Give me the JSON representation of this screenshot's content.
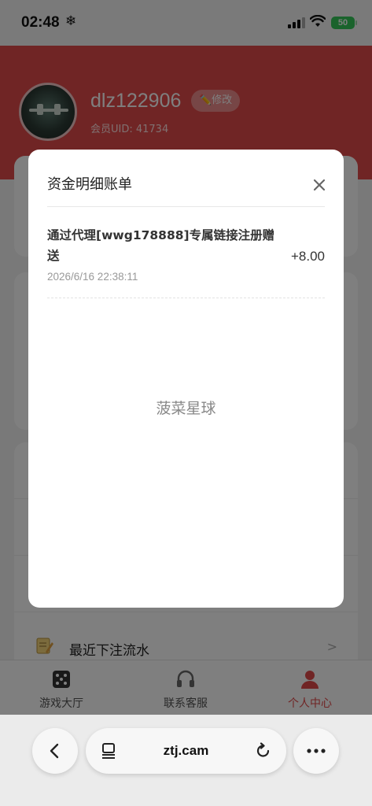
{
  "status_bar": {
    "time": "02:48",
    "battery": "50"
  },
  "profile": {
    "username": "dlz122906",
    "edit_label": "✏️修改",
    "uid_text": "会员UID: 41734"
  },
  "recent_bets": {
    "label": "最近下注流水",
    "arrow": ">"
  },
  "tab_bar": {
    "tabs": [
      {
        "label": "游戏大厅",
        "icon": "dice-icon",
        "active": false
      },
      {
        "label": "联系客服",
        "icon": "headset-icon",
        "active": false
      },
      {
        "label": "个人中心",
        "icon": "user-icon",
        "active": true
      }
    ],
    "active_color": "#e14b4b"
  },
  "browser": {
    "url": "ztj.cam"
  },
  "modal": {
    "title": "资金明细账单",
    "records": [
      {
        "description": "通过代理[wwg178888]专属链接注册赠送",
        "amount": "+8.00",
        "time": "2026/6/16 22:38:11"
      }
    ],
    "watermark": "菠菜星球"
  },
  "colors": {
    "brand_red": "#e14b4b",
    "battery_green": "#35c759"
  }
}
